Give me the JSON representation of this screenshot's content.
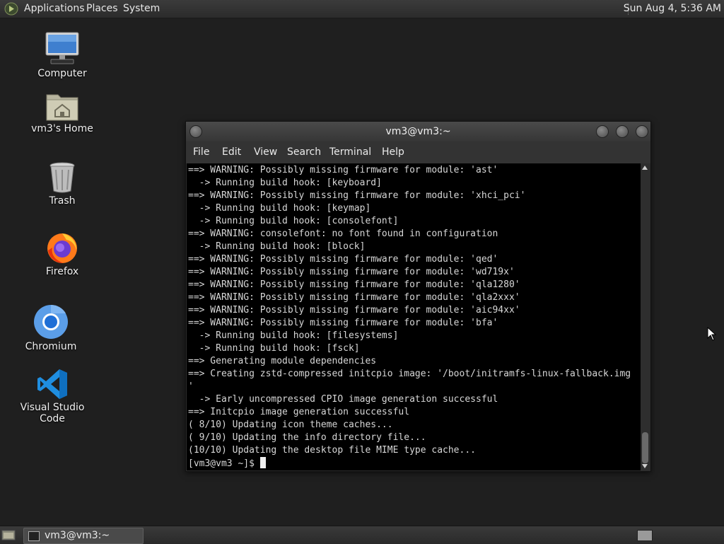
{
  "top_panel": {
    "menus": [
      "Applications",
      "Places",
      "System"
    ],
    "clock": "Sun Aug  4, 5:36 AM"
  },
  "desktop": {
    "icons": [
      {
        "label": "Computer",
        "icon": "monitor-icon"
      },
      {
        "label": "vm3's Home",
        "icon": "home-folder-icon"
      },
      {
        "label": "Trash",
        "icon": "trash-icon"
      },
      {
        "label": "Firefox",
        "icon": "firefox-icon"
      },
      {
        "label": "Chromium",
        "icon": "chromium-icon"
      },
      {
        "label": "Visual Studio Code",
        "icon": "vscode-icon"
      }
    ]
  },
  "terminal": {
    "title": "vm3@vm3:~",
    "menu": [
      "File",
      "Edit",
      "View",
      "Search",
      "Terminal",
      "Help"
    ],
    "lines": [
      "==> WARNING: Possibly missing firmware for module: 'ast'",
      "  -> Running build hook: [keyboard]",
      "==> WARNING: Possibly missing firmware for module: 'xhci_pci'",
      "  -> Running build hook: [keymap]",
      "  -> Running build hook: [consolefont]",
      "==> WARNING: consolefont: no font found in configuration",
      "  -> Running build hook: [block]",
      "==> WARNING: Possibly missing firmware for module: 'qed'",
      "==> WARNING: Possibly missing firmware for module: 'wd719x'",
      "==> WARNING: Possibly missing firmware for module: 'qla1280'",
      "==> WARNING: Possibly missing firmware for module: 'qla2xxx'",
      "==> WARNING: Possibly missing firmware for module: 'aic94xx'",
      "==> WARNING: Possibly missing firmware for module: 'bfa'",
      "  -> Running build hook: [filesystems]",
      "  -> Running build hook: [fsck]",
      "==> Generating module dependencies",
      "==> Creating zstd-compressed initcpio image: '/boot/initramfs-linux-fallback.img",
      "'",
      "  -> Early uncompressed CPIO image generation successful",
      "==> Initcpio image generation successful",
      "( 8/10) Updating icon theme caches...",
      "( 9/10) Updating the info directory file...",
      "(10/10) Updating the desktop file MIME type cache..."
    ],
    "prompt": "[vm3@vm3 ~]$ "
  },
  "taskbar": {
    "items": [
      {
        "label": "vm3@vm3:~"
      }
    ]
  },
  "colors": {
    "desktop_bg": "#1f1f1f",
    "terminal_bg": "#000000",
    "terminal_fg": "#d7d7d7",
    "panel_bg": "#2f2f2f"
  }
}
